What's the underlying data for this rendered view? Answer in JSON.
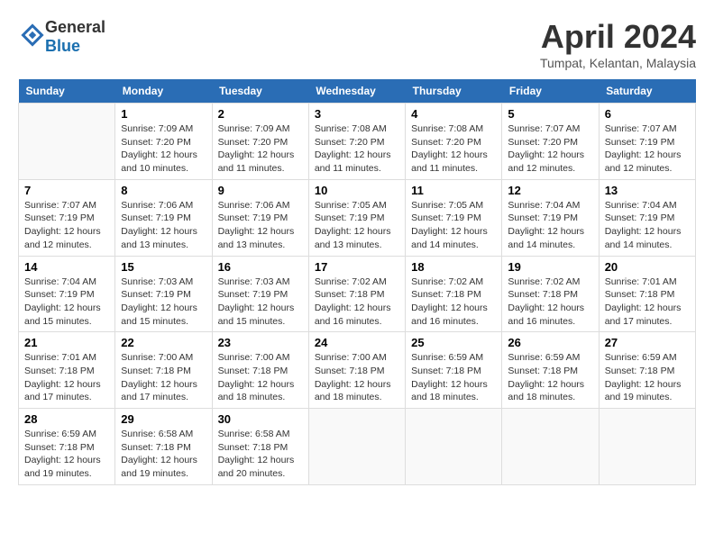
{
  "header": {
    "logo_general": "General",
    "logo_blue": "Blue",
    "month_title": "April 2024",
    "location": "Tumpat, Kelantan, Malaysia"
  },
  "days_of_week": [
    "Sunday",
    "Monday",
    "Tuesday",
    "Wednesday",
    "Thursday",
    "Friday",
    "Saturday"
  ],
  "weeks": [
    [
      {
        "day": "",
        "info": ""
      },
      {
        "day": "1",
        "info": "Sunrise: 7:09 AM\nSunset: 7:20 PM\nDaylight: 12 hours\nand 10 minutes."
      },
      {
        "day": "2",
        "info": "Sunrise: 7:09 AM\nSunset: 7:20 PM\nDaylight: 12 hours\nand 11 minutes."
      },
      {
        "day": "3",
        "info": "Sunrise: 7:08 AM\nSunset: 7:20 PM\nDaylight: 12 hours\nand 11 minutes."
      },
      {
        "day": "4",
        "info": "Sunrise: 7:08 AM\nSunset: 7:20 PM\nDaylight: 12 hours\nand 11 minutes."
      },
      {
        "day": "5",
        "info": "Sunrise: 7:07 AM\nSunset: 7:20 PM\nDaylight: 12 hours\nand 12 minutes."
      },
      {
        "day": "6",
        "info": "Sunrise: 7:07 AM\nSunset: 7:19 PM\nDaylight: 12 hours\nand 12 minutes."
      }
    ],
    [
      {
        "day": "7",
        "info": ""
      },
      {
        "day": "8",
        "info": "Sunrise: 7:06 AM\nSunset: 7:19 PM\nDaylight: 12 hours\nand 13 minutes."
      },
      {
        "day": "9",
        "info": "Sunrise: 7:06 AM\nSunset: 7:19 PM\nDaylight: 12 hours\nand 13 minutes."
      },
      {
        "day": "10",
        "info": "Sunrise: 7:05 AM\nSunset: 7:19 PM\nDaylight: 12 hours\nand 13 minutes."
      },
      {
        "day": "11",
        "info": "Sunrise: 7:05 AM\nSunset: 7:19 PM\nDaylight: 12 hours\nand 14 minutes."
      },
      {
        "day": "12",
        "info": "Sunrise: 7:04 AM\nSunset: 7:19 PM\nDaylight: 12 hours\nand 14 minutes."
      },
      {
        "day": "13",
        "info": "Sunrise: 7:04 AM\nSunset: 7:19 PM\nDaylight: 12 hours\nand 14 minutes."
      }
    ],
    [
      {
        "day": "14",
        "info": ""
      },
      {
        "day": "15",
        "info": "Sunrise: 7:03 AM\nSunset: 7:19 PM\nDaylight: 12 hours\nand 15 minutes."
      },
      {
        "day": "16",
        "info": "Sunrise: 7:03 AM\nSunset: 7:19 PM\nDaylight: 12 hours\nand 15 minutes."
      },
      {
        "day": "17",
        "info": "Sunrise: 7:02 AM\nSunset: 7:18 PM\nDaylight: 12 hours\nand 16 minutes."
      },
      {
        "day": "18",
        "info": "Sunrise: 7:02 AM\nSunset: 7:18 PM\nDaylight: 12 hours\nand 16 minutes."
      },
      {
        "day": "19",
        "info": "Sunrise: 7:02 AM\nSunset: 7:18 PM\nDaylight: 12 hours\nand 16 minutes."
      },
      {
        "day": "20",
        "info": "Sunrise: 7:01 AM\nSunset: 7:18 PM\nDaylight: 12 hours\nand 17 minutes."
      }
    ],
    [
      {
        "day": "21",
        "info": ""
      },
      {
        "day": "22",
        "info": "Sunrise: 7:00 AM\nSunset: 7:18 PM\nDaylight: 12 hours\nand 17 minutes."
      },
      {
        "day": "23",
        "info": "Sunrise: 7:00 AM\nSunset: 7:18 PM\nDaylight: 12 hours\nand 18 minutes."
      },
      {
        "day": "24",
        "info": "Sunrise: 7:00 AM\nSunset: 7:18 PM\nDaylight: 12 hours\nand 18 minutes."
      },
      {
        "day": "25",
        "info": "Sunrise: 6:59 AM\nSunset: 7:18 PM\nDaylight: 12 hours\nand 18 minutes."
      },
      {
        "day": "26",
        "info": "Sunrise: 6:59 AM\nSunset: 7:18 PM\nDaylight: 12 hours\nand 18 minutes."
      },
      {
        "day": "27",
        "info": "Sunrise: 6:59 AM\nSunset: 7:18 PM\nDaylight: 12 hours\nand 19 minutes."
      }
    ],
    [
      {
        "day": "28",
        "info": "Sunrise: 6:59 AM\nSunset: 7:18 PM\nDaylight: 12 hours\nand 19 minutes."
      },
      {
        "day": "29",
        "info": "Sunrise: 6:58 AM\nSunset: 7:18 PM\nDaylight: 12 hours\nand 19 minutes."
      },
      {
        "day": "30",
        "info": "Sunrise: 6:58 AM\nSunset: 7:18 PM\nDaylight: 12 hours\nand 20 minutes."
      },
      {
        "day": "",
        "info": ""
      },
      {
        "day": "",
        "info": ""
      },
      {
        "day": "",
        "info": ""
      },
      {
        "day": "",
        "info": ""
      }
    ]
  ],
  "week7_sunday_info": "Sunrise: 7:07 AM\nSunset: 7:19 PM\nDaylight: 12 hours\nand 12 minutes.",
  "week14_sunday_info": "Sunrise: 7:04 AM\nSunset: 7:19 PM\nDaylight: 12 hours\nand 15 minutes.",
  "week21_sunday_info": "Sunrise: 7:01 AM\nSunset: 7:18 PM\nDaylight: 12 hours\nand 17 minutes."
}
